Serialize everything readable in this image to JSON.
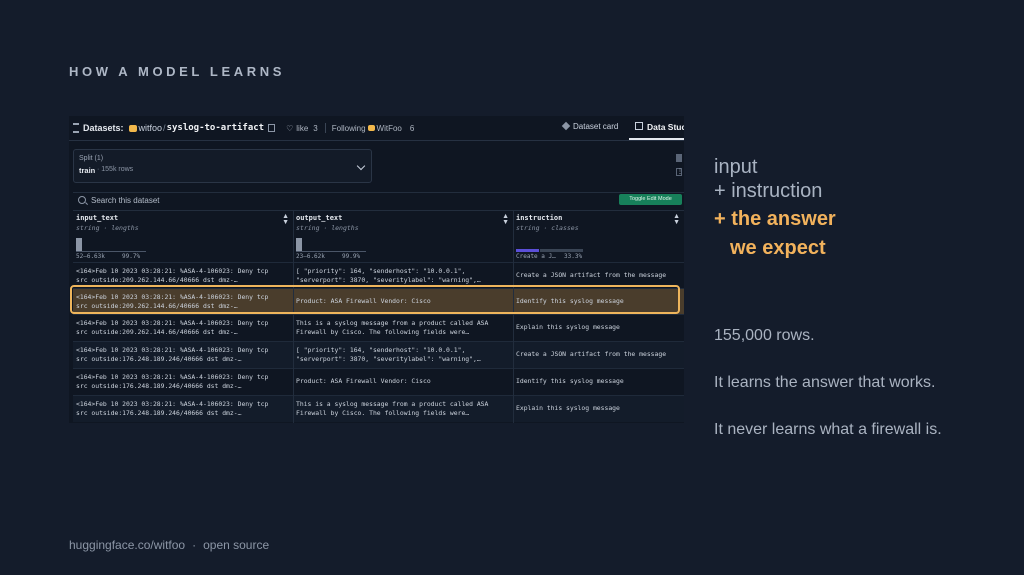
{
  "slide": {
    "title": "HOW A MODEL LEARNS",
    "footer": {
      "site": "huggingface.co/witfoo",
      "separator": "·",
      "tag": "open source"
    }
  },
  "hf": {
    "breadcrumb_label": "Datasets:",
    "org": "witfoo",
    "slash": "/",
    "repo": "syslog-to-artifact",
    "like_label": "like",
    "like_count": "3",
    "following_label": "Following",
    "following_org": "WitFoo",
    "following_count": "6",
    "tab_card": "Dataset card",
    "tab_studio": "Data Stud",
    "split_label": "Split (1)",
    "split_name": "train",
    "split_rows": "· 155k rows",
    "search_placeholder": "Search this dataset",
    "toggle_label": "Toggle Edit Mode",
    "columns": [
      {
        "name": "input_text",
        "type": "string · lengths",
        "range_lo": "52–6.63k",
        "range_hi": "99.7%"
      },
      {
        "name": "output_text",
        "type": "string · lengths",
        "range_lo": "23–6.62k",
        "range_hi": "99.9%"
      },
      {
        "name": "instruction",
        "type": "string · classes",
        "range_lo": "Create a J…",
        "range_hi": "33.3%"
      }
    ],
    "rows": [
      {
        "input": "<164>Feb 10 2023 03:28:21: %ASA-4-106023: Deny tcp\nsrc outside:209.262.144.66/40666 dst dmz-…",
        "output": "[ \"priority\": 164, \"senderhost\": \"10.0.0.1\",\n\"serverport\": 3870, \"severitylabel\": \"warning\",…",
        "instruction": "Create a JSON artifact from the message"
      },
      {
        "input": "<164>Feb 10 2023 03:28:21: %ASA-4-106023: Deny tcp\nsrc outside:209.262.144.66/40666 dst dmz-…",
        "output": "Product: ASA Firewall Vendor: Cisco",
        "instruction": "Identify this syslog message"
      },
      {
        "input": "<164>Feb 10 2023 03:28:21: %ASA-4-106023: Deny tcp\nsrc outside:209.262.144.66/40666 dst dmz-…",
        "output": "This is a syslog message from a product called ASA\nFirewall by Cisco. The following fields were…",
        "instruction": "Explain this syslog message"
      },
      {
        "input": "<164>Feb 10 2023 03:28:21: %ASA-4-106023: Deny tcp\nsrc outside:176.248.189.246/40666 dst dmz-…",
        "output": "[ \"priority\": 164, \"senderhost\": \"10.0.0.1\",\n\"serverport\": 3870, \"severitylabel\": \"warning\",…",
        "instruction": "Create a JSON artifact from the message"
      },
      {
        "input": "<164>Feb 10 2023 03:28:21: %ASA-4-106023: Deny tcp\nsrc outside:176.248.189.246/40666 dst dmz-…",
        "output": "Product: ASA Firewall Vendor: Cisco",
        "instruction": "Identify this syslog message"
      },
      {
        "input": "<164>Feb 10 2023 03:28:21: %ASA-4-106023: Deny tcp\nsrc outside:176.248.189.246/40666 dst dmz-…",
        "output": "This is a syslog message from a product called ASA\nFirewall by Cisco. The following fields were…",
        "instruction": "Explain this syslog message"
      }
    ],
    "highlighted_row": 1
  },
  "side": {
    "line_input": "input",
    "line_instruction": "+ instruction",
    "line_answer_1": "+ the answer",
    "line_answer_2": "we expect",
    "para_1": "155,000 rows.",
    "para_2": "It learns the answer that works.",
    "para_3": "It never learns what a firewall is."
  },
  "colors": {
    "background": "#141c2b",
    "accent": "#f2b25c",
    "highlight_border": "#eeb55c",
    "toggle_green": "#17805a"
  }
}
